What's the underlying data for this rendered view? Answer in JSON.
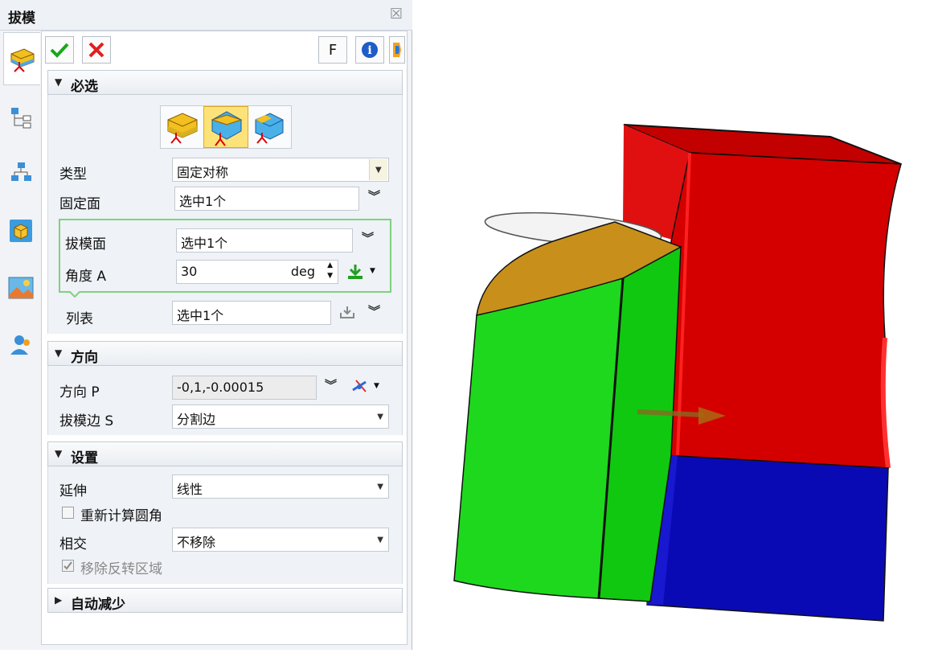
{
  "dialog": {
    "title": "拔模",
    "toolbar": {
      "f_label": "F"
    },
    "sections": {
      "required": {
        "label": "必选",
        "type_label": "类型",
        "type_value": "固定对称",
        "fixed_face_label": "固定面",
        "fixed_face_value": "选中1个",
        "draft_face_label": "拔模面",
        "draft_face_value": "选中1个",
        "angle_label": "角度 A",
        "angle_value": "30",
        "angle_unit": "deg",
        "list_label": "列表",
        "list_value": "选中1个"
      },
      "direction": {
        "label": "方向",
        "dir_label": "方向 P",
        "dir_value": "-0,1,-0.00015",
        "edge_label": "拔模边 S",
        "edge_value": "分割边"
      },
      "settings": {
        "label": "设置",
        "extend_label": "延伸",
        "extend_value": "线性",
        "recalc_label": "重新计算圆角",
        "intersect_label": "相交",
        "intersect_value": "不移除",
        "remove_label": "移除反转区域"
      },
      "auto_reduce": {
        "label": "自动减少"
      }
    }
  },
  "colors": {
    "red_face": "#d80000",
    "blue_face": "#0a0ab4",
    "green_face": "#10d010",
    "top_face": "#c8901a"
  }
}
